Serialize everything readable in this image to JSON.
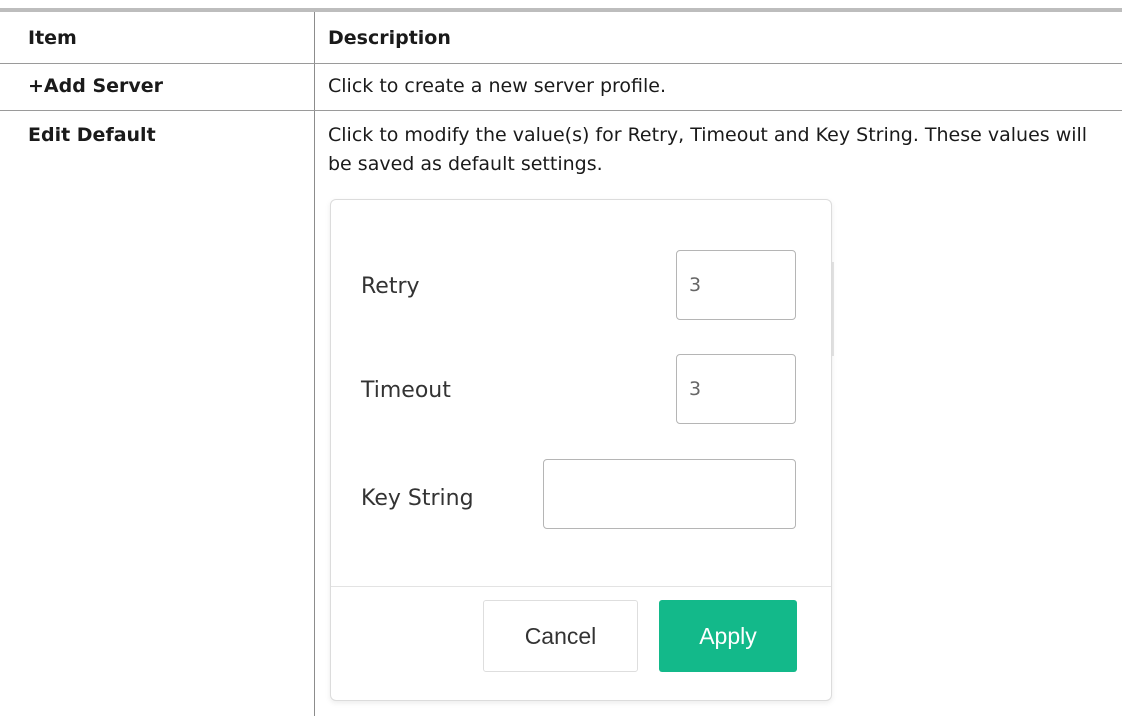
{
  "table": {
    "header": {
      "item": "Item",
      "description": "Description"
    },
    "rows": [
      {
        "item": "+Add Server",
        "description": "Click to create a new server profile."
      },
      {
        "item": "Edit Default",
        "description": "Click to modify the value(s) for Retry, Timeout and Key String. These values will be saved as default settings."
      }
    ]
  },
  "dialog": {
    "retry_label": "Retry",
    "retry_value": "3",
    "timeout_label": "Timeout",
    "timeout_value": "3",
    "key_string_label": "Key String",
    "key_string_value": "",
    "cancel_label": "Cancel",
    "apply_label": "Apply"
  },
  "colors": {
    "apply_button": "#13b98a",
    "top_rule": "#bdbdbd"
  }
}
